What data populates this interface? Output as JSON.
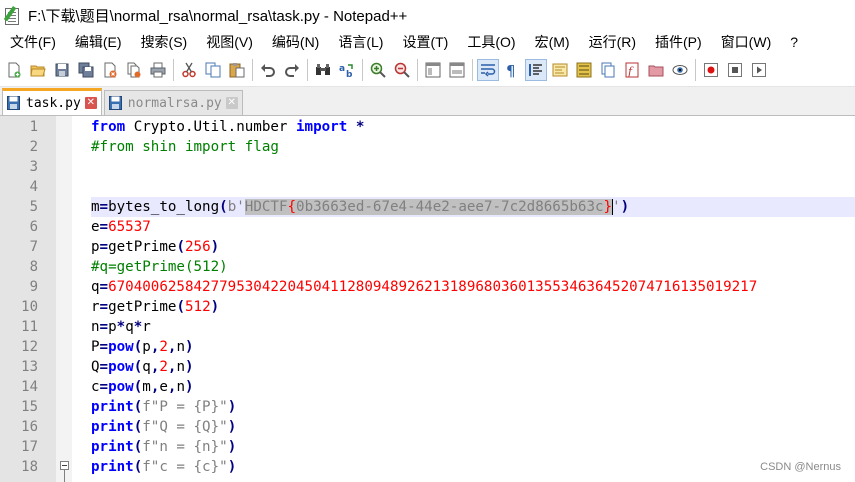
{
  "window": {
    "title": "F:\\下载\\题目\\normal_rsa\\normal_rsa\\task.py - Notepad++"
  },
  "menu": [
    "文件(F)",
    "编辑(E)",
    "搜索(S)",
    "视图(V)",
    "编码(N)",
    "语言(L)",
    "设置(T)",
    "工具(O)",
    "宏(M)",
    "运行(R)",
    "插件(P)",
    "窗口(W)",
    "?"
  ],
  "toolbar": {
    "icons": [
      "new-file-icon",
      "open-file-icon",
      "save-icon",
      "save-all-icon",
      "close-icon",
      "close-all-icon",
      "print-icon",
      "cut-icon",
      "copy-icon",
      "paste-icon",
      "undo-icon",
      "redo-icon",
      "find-icon",
      "replace-icon",
      "zoom-in-icon",
      "zoom-out-icon",
      "sync-vertical-icon",
      "sync-horizontal-icon",
      "word-wrap-icon",
      "show-all-chars-icon",
      "indent-guide-icon",
      "doc-map-icon",
      "function-list-icon",
      "folder-workspace-icon",
      "monitoring-icon",
      "record-macro-icon",
      "stop-macro-icon"
    ]
  },
  "tabs": [
    {
      "label": "task.py",
      "active": true
    },
    {
      "label": "normalrsa.py",
      "active": false
    }
  ],
  "editor": {
    "line_numbers": [
      "1",
      "2",
      "3",
      "4",
      "5",
      "6",
      "7",
      "8",
      "9",
      "10",
      "11",
      "12",
      "13",
      "14",
      "15",
      "16",
      "17",
      "18"
    ],
    "current_line": 5,
    "lines": [
      [
        {
          "t": "from",
          "c": "kw"
        },
        {
          "t": " Crypto.Util.number ",
          "c": ""
        },
        {
          "t": "import",
          "c": "kw"
        },
        {
          "t": " ",
          "c": ""
        },
        {
          "t": "*",
          "c": "op"
        }
      ],
      [
        {
          "t": "#from shin import flag",
          "c": "cm"
        }
      ],
      [],
      [],
      [
        {
          "t": "m",
          "c": ""
        },
        {
          "t": "=",
          "c": "op"
        },
        {
          "t": "bytes_to_long",
          "c": ""
        },
        {
          "t": "(",
          "c": "op"
        },
        {
          "t": "b'",
          "c": "str"
        },
        {
          "t": "HDCTF",
          "c": "str sel"
        },
        {
          "t": "{",
          "c": "num sel"
        },
        {
          "t": "0b3663ed-67e4-44e2-aee7-7c2d8665b63c",
          "c": "str sel"
        },
        {
          "t": "}",
          "c": "num sel"
        },
        {
          "t": "'",
          "c": "str caretafter"
        },
        {
          "t": ")",
          "c": "op"
        }
      ],
      [
        {
          "t": "e",
          "c": ""
        },
        {
          "t": "=",
          "c": "op"
        },
        {
          "t": "65537",
          "c": "num"
        }
      ],
      [
        {
          "t": "p",
          "c": ""
        },
        {
          "t": "=",
          "c": "op"
        },
        {
          "t": "getPrime",
          "c": ""
        },
        {
          "t": "(",
          "c": "op"
        },
        {
          "t": "256",
          "c": "num"
        },
        {
          "t": ")",
          "c": "op"
        }
      ],
      [
        {
          "t": "#q=getPrime(512)",
          "c": "cm"
        }
      ],
      [
        {
          "t": "q",
          "c": ""
        },
        {
          "t": "=",
          "c": "op"
        },
        {
          "t": "6704006258427795304220450411280948926213189680360135534636452074716135019217",
          "c": "num"
        }
      ],
      [
        {
          "t": "r",
          "c": ""
        },
        {
          "t": "=",
          "c": "op"
        },
        {
          "t": "getPrime",
          "c": ""
        },
        {
          "t": "(",
          "c": "op"
        },
        {
          "t": "512",
          "c": "num"
        },
        {
          "t": ")",
          "c": "op"
        }
      ],
      [
        {
          "t": "n",
          "c": ""
        },
        {
          "t": "=",
          "c": "op"
        },
        {
          "t": "p",
          "c": ""
        },
        {
          "t": "*",
          "c": "op"
        },
        {
          "t": "q",
          "c": ""
        },
        {
          "t": "*",
          "c": "op"
        },
        {
          "t": "r",
          "c": ""
        }
      ],
      [
        {
          "t": "P",
          "c": ""
        },
        {
          "t": "=",
          "c": "op"
        },
        {
          "t": "pow",
          "c": "kw"
        },
        {
          "t": "(",
          "c": "op"
        },
        {
          "t": "p",
          "c": ""
        },
        {
          "t": ",",
          "c": "op"
        },
        {
          "t": "2",
          "c": "num"
        },
        {
          "t": ",",
          "c": "op"
        },
        {
          "t": "n",
          "c": ""
        },
        {
          "t": ")",
          "c": "op"
        }
      ],
      [
        {
          "t": "Q",
          "c": ""
        },
        {
          "t": "=",
          "c": "op"
        },
        {
          "t": "pow",
          "c": "kw"
        },
        {
          "t": "(",
          "c": "op"
        },
        {
          "t": "q",
          "c": ""
        },
        {
          "t": ",",
          "c": "op"
        },
        {
          "t": "2",
          "c": "num"
        },
        {
          "t": ",",
          "c": "op"
        },
        {
          "t": "n",
          "c": ""
        },
        {
          "t": ")",
          "c": "op"
        }
      ],
      [
        {
          "t": "c",
          "c": ""
        },
        {
          "t": "=",
          "c": "op"
        },
        {
          "t": "pow",
          "c": "kw"
        },
        {
          "t": "(",
          "c": "op"
        },
        {
          "t": "m",
          "c": ""
        },
        {
          "t": ",",
          "c": "op"
        },
        {
          "t": "e",
          "c": ""
        },
        {
          "t": ",",
          "c": "op"
        },
        {
          "t": "n",
          "c": ""
        },
        {
          "t": ")",
          "c": "op"
        }
      ],
      [
        {
          "t": "print",
          "c": "kw"
        },
        {
          "t": "(",
          "c": "op"
        },
        {
          "t": "f\"P = {P}\"",
          "c": "str"
        },
        {
          "t": ")",
          "c": "op"
        }
      ],
      [
        {
          "t": "print",
          "c": "kw"
        },
        {
          "t": "(",
          "c": "op"
        },
        {
          "t": "f\"Q = {Q}\"",
          "c": "str"
        },
        {
          "t": ")",
          "c": "op"
        }
      ],
      [
        {
          "t": "print",
          "c": "kw"
        },
        {
          "t": "(",
          "c": "op"
        },
        {
          "t": "f\"n = {n}\"",
          "c": "str"
        },
        {
          "t": ")",
          "c": "op"
        }
      ],
      [
        {
          "t": "print",
          "c": "kw"
        },
        {
          "t": "(",
          "c": "op"
        },
        {
          "t": "f\"c = {c}\"",
          "c": "str"
        },
        {
          "t": ")",
          "c": "op"
        }
      ]
    ]
  },
  "watermark": "CSDN @Nernus",
  "colors": {
    "keyword": "#0000ff",
    "comment": "#008000",
    "number": "#ff0000",
    "operator": "#000080",
    "string": "#808080",
    "selection": "#c0c0c0",
    "current_line": "#e8e8ff",
    "active_tab_accent": "#f5a623"
  }
}
